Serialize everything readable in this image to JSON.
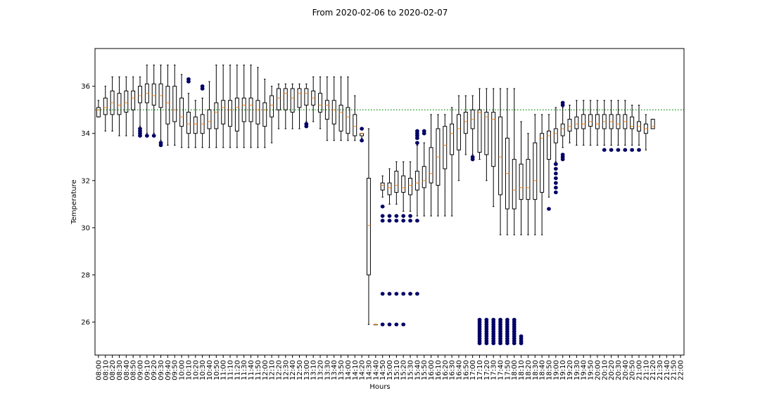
{
  "chart_data": {
    "type": "box",
    "title": "From 2020-02-06 to 2020-02-07",
    "xlabel": "Hours",
    "ylabel": "Temperature",
    "ylim": [
      24.6,
      37.6
    ],
    "yticks": [
      26,
      28,
      30,
      32,
      34,
      36
    ],
    "reference_line": {
      "value": 35.0,
      "color": "#2ca02c",
      "style": "dotted"
    },
    "colors": {
      "box": "#000000",
      "median": "#ff7f0e",
      "outlier": "#000066",
      "frame": "#000000"
    },
    "categories": [
      "08:00",
      "08:10",
      "08:20",
      "08:30",
      "08:40",
      "08:50",
      "09:00",
      "09:10",
      "09:20",
      "09:30",
      "09:40",
      "09:50",
      "10:00",
      "10:10",
      "10:20",
      "10:30",
      "10:40",
      "10:50",
      "11:00",
      "11:10",
      "11:20",
      "11:30",
      "11:40",
      "11:50",
      "12:00",
      "12:10",
      "12:20",
      "12:30",
      "12:40",
      "12:50",
      "13:00",
      "13:10",
      "13:20",
      "13:30",
      "13:40",
      "13:50",
      "14:00",
      "14:10",
      "14:20",
      "14:30",
      "14:40",
      "14:50",
      "15:00",
      "15:10",
      "15:20",
      "15:30",
      "15:40",
      "15:50",
      "16:00",
      "16:10",
      "16:20",
      "16:30",
      "16:40",
      "16:50",
      "17:00",
      "17:10",
      "17:20",
      "17:30",
      "17:40",
      "17:50",
      "18:00",
      "18:10",
      "18:20",
      "18:30",
      "18:40",
      "18:50",
      "19:00",
      "19:10",
      "19:20",
      "19:30",
      "19:40",
      "19:50",
      "20:00",
      "20:10",
      "20:20",
      "20:30",
      "20:40",
      "20:50",
      "21:00",
      "21:10",
      "21:20",
      "21:30",
      "21:40",
      "21:50",
      "22:00"
    ],
    "boxes": [
      {
        "wl": 34.7,
        "q1": 34.7,
        "med": 35.0,
        "q3": 35.1,
        "wh": 35.4,
        "out": []
      },
      {
        "wl": 34.1,
        "q1": 34.8,
        "med": 35.1,
        "q3": 35.5,
        "wh": 36.0,
        "out": []
      },
      {
        "wl": 34.1,
        "q1": 34.8,
        "med": 35.3,
        "q3": 35.8,
        "wh": 36.4,
        "out": []
      },
      {
        "wl": 33.9,
        "q1": 34.8,
        "med": 35.2,
        "q3": 35.7,
        "wh": 36.4,
        "out": []
      },
      {
        "wl": 33.9,
        "q1": 34.9,
        "med": 35.3,
        "q3": 35.8,
        "wh": 36.4,
        "out": []
      },
      {
        "wl": 33.9,
        "q1": 35.0,
        "med": 35.5,
        "q3": 35.8,
        "wh": 36.4,
        "out": []
      },
      {
        "wl": 34.3,
        "q1": 35.3,
        "med": 35.6,
        "q3": 36.0,
        "wh": 36.4,
        "out": [
          34.2,
          34.1,
          34.0,
          33.9
        ]
      },
      {
        "wl": 34.0,
        "q1": 35.3,
        "med": 35.7,
        "q3": 36.1,
        "wh": 36.9,
        "out": [
          33.9
        ]
      },
      {
        "wl": 34.0,
        "q1": 35.2,
        "med": 35.6,
        "q3": 36.1,
        "wh": 36.9,
        "out": [
          33.9
        ]
      },
      {
        "wl": 33.7,
        "q1": 35.1,
        "med": 35.6,
        "q3": 36.1,
        "wh": 36.9,
        "out": [
          33.6,
          33.5
        ]
      },
      {
        "wl": 33.5,
        "q1": 34.4,
        "med": 35.3,
        "q3": 36.0,
        "wh": 36.9,
        "out": []
      },
      {
        "wl": 33.5,
        "q1": 34.5,
        "med": 35.0,
        "q3": 36.0,
        "wh": 36.9,
        "out": []
      },
      {
        "wl": 33.4,
        "q1": 34.3,
        "med": 34.7,
        "q3": 35.5,
        "wh": 36.5,
        "out": []
      },
      {
        "wl": 33.4,
        "q1": 34.0,
        "med": 34.4,
        "q3": 34.9,
        "wh": 35.7,
        "out": [
          36.3,
          36.2
        ]
      },
      {
        "wl": 33.4,
        "q1": 34.0,
        "med": 34.4,
        "q3": 34.7,
        "wh": 35.4,
        "out": []
      },
      {
        "wl": 33.4,
        "q1": 34.0,
        "med": 34.4,
        "q3": 34.8,
        "wh": 35.5,
        "out": [
          36.0,
          35.9
        ]
      },
      {
        "wl": 33.4,
        "q1": 34.2,
        "med": 34.5,
        "q3": 35.0,
        "wh": 36.2,
        "out": []
      },
      {
        "wl": 33.4,
        "q1": 34.2,
        "med": 34.9,
        "q3": 35.3,
        "wh": 36.9,
        "out": []
      },
      {
        "wl": 33.4,
        "q1": 34.4,
        "med": 35.1,
        "q3": 35.4,
        "wh": 36.9,
        "out": []
      },
      {
        "wl": 33.4,
        "q1": 34.3,
        "med": 35.0,
        "q3": 35.4,
        "wh": 36.9,
        "out": []
      },
      {
        "wl": 33.4,
        "q1": 34.1,
        "med": 35.1,
        "q3": 35.5,
        "wh": 36.9,
        "out": []
      },
      {
        "wl": 33.4,
        "q1": 34.5,
        "med": 35.2,
        "q3": 35.5,
        "wh": 36.9,
        "out": []
      },
      {
        "wl": 33.4,
        "q1": 34.5,
        "med": 35.2,
        "q3": 35.5,
        "wh": 36.9,
        "out": []
      },
      {
        "wl": 33.4,
        "q1": 34.4,
        "med": 35.0,
        "q3": 35.4,
        "wh": 36.8,
        "out": []
      },
      {
        "wl": 33.4,
        "q1": 34.3,
        "med": 35.0,
        "q3": 35.3,
        "wh": 36.3,
        "out": []
      },
      {
        "wl": 33.6,
        "q1": 34.7,
        "med": 35.2,
        "q3": 35.6,
        "wh": 36.0,
        "out": []
      },
      {
        "wl": 34.2,
        "q1": 35.0,
        "med": 35.5,
        "q3": 35.9,
        "wh": 36.1,
        "out": []
      },
      {
        "wl": 34.2,
        "q1": 35.0,
        "med": 35.7,
        "q3": 35.9,
        "wh": 36.1,
        "out": []
      },
      {
        "wl": 34.2,
        "q1": 34.9,
        "med": 35.5,
        "q3": 35.9,
        "wh": 36.1,
        "out": []
      },
      {
        "wl": 34.2,
        "q1": 35.1,
        "med": 35.7,
        "q3": 35.9,
        "wh": 36.1,
        "out": []
      },
      {
        "wl": 34.5,
        "q1": 35.2,
        "med": 35.7,
        "q3": 35.9,
        "wh": 36.1,
        "out": [
          34.4,
          34.3
        ]
      },
      {
        "wl": 34.5,
        "q1": 35.2,
        "med": 35.5,
        "q3": 35.8,
        "wh": 36.4,
        "out": []
      },
      {
        "wl": 34.2,
        "q1": 34.9,
        "med": 35.2,
        "q3": 35.7,
        "wh": 36.4,
        "out": []
      },
      {
        "wl": 33.7,
        "q1": 34.6,
        "med": 35.2,
        "q3": 35.4,
        "wh": 36.4,
        "out": []
      },
      {
        "wl": 33.7,
        "q1": 34.4,
        "med": 35.0,
        "q3": 35.4,
        "wh": 36.4,
        "out": []
      },
      {
        "wl": 33.7,
        "q1": 34.1,
        "med": 34.9,
        "q3": 35.2,
        "wh": 36.4,
        "out": []
      },
      {
        "wl": 33.7,
        "q1": 34.0,
        "med": 34.7,
        "q3": 35.1,
        "wh": 36.4,
        "out": []
      },
      {
        "wl": 33.7,
        "q1": 33.9,
        "med": 34.3,
        "q3": 34.8,
        "wh": 35.6,
        "out": []
      },
      {
        "wl": 33.8,
        "q1": 33.9,
        "med": 34.0,
        "q3": 34.0,
        "wh": 34.0,
        "out": [
          34.2,
          33.7
        ]
      },
      {
        "wl": 25.9,
        "q1": 28.0,
        "med": 30.1,
        "q3": 32.1,
        "wh": 34.2,
        "out": []
      },
      {
        "wl": 25.9,
        "q1": 25.9,
        "med": 25.9,
        "q3": 25.9,
        "wh": 25.9,
        "out": []
      },
      {
        "wl": 31.3,
        "q1": 31.6,
        "med": 31.8,
        "q3": 31.9,
        "wh": 32.2,
        "out": [
          30.9,
          30.5,
          30.3,
          27.2,
          25.9
        ]
      },
      {
        "wl": 31.0,
        "q1": 31.4,
        "med": 31.7,
        "q3": 31.9,
        "wh": 32.5,
        "out": [
          30.5,
          30.3,
          27.2,
          25.9
        ]
      },
      {
        "wl": 31.0,
        "q1": 31.5,
        "med": 31.8,
        "q3": 32.4,
        "wh": 32.8,
        "out": [
          30.5,
          30.3,
          27.2,
          25.9
        ]
      },
      {
        "wl": 30.7,
        "q1": 31.5,
        "med": 31.7,
        "q3": 32.2,
        "wh": 32.8,
        "out": [
          30.5,
          30.3,
          27.2,
          25.9
        ]
      },
      {
        "wl": 30.7,
        "q1": 31.4,
        "med": 31.8,
        "q3": 32.1,
        "wh": 32.8,
        "out": [
          30.5,
          30.3,
          27.2
        ]
      },
      {
        "wl": 30.5,
        "q1": 31.6,
        "med": 31.9,
        "q3": 32.4,
        "wh": 33.5,
        "out": [
          34.1,
          34.0,
          33.9,
          33.8,
          33.6,
          30.3,
          27.2
        ]
      },
      {
        "wl": 30.5,
        "q1": 31.7,
        "med": 32.0,
        "q3": 32.6,
        "wh": 33.6,
        "out": [
          34.1,
          34.0
        ]
      },
      {
        "wl": 30.5,
        "q1": 31.9,
        "med": 32.3,
        "q3": 33.4,
        "wh": 34.8,
        "out": []
      },
      {
        "wl": 30.5,
        "q1": 31.8,
        "med": 33.0,
        "q3": 34.2,
        "wh": 34.8,
        "out": []
      },
      {
        "wl": 30.5,
        "q1": 32.5,
        "med": 33.5,
        "q3": 34.3,
        "wh": 34.8,
        "out": []
      },
      {
        "wl": 30.5,
        "q1": 33.1,
        "med": 34.0,
        "q3": 34.4,
        "wh": 35.1,
        "out": []
      },
      {
        "wl": 32.0,
        "q1": 33.3,
        "med": 34.2,
        "q3": 34.8,
        "wh": 35.6,
        "out": []
      },
      {
        "wl": 33.1,
        "q1": 34.0,
        "med": 34.5,
        "q3": 34.9,
        "wh": 35.6,
        "out": []
      },
      {
        "wl": 33.1,
        "q1": 34.2,
        "med": 34.6,
        "q3": 35.0,
        "wh": 35.6,
        "out": [
          33.0,
          32.9
        ]
      },
      {
        "wl": 32.9,
        "q1": 33.2,
        "med": 34.9,
        "q3": 35.0,
        "wh": 35.9,
        "out": [
          26.1,
          26.0,
          25.9,
          25.8,
          25.7,
          25.6,
          25.5,
          25.4,
          25.3,
          25.2,
          25.1
        ]
      },
      {
        "wl": 32.0,
        "q1": 33.1,
        "med": 34.7,
        "q3": 34.9,
        "wh": 35.9,
        "out": [
          26.1,
          26.0,
          25.9,
          25.8,
          25.7,
          25.6,
          25.5,
          25.4,
          25.3,
          25.2,
          25.1
        ]
      },
      {
        "wl": 30.9,
        "q1": 32.6,
        "med": 34.6,
        "q3": 34.9,
        "wh": 35.9,
        "out": [
          26.1,
          26.0,
          25.9,
          25.8,
          25.7,
          25.6,
          25.5,
          25.4,
          25.3,
          25.2,
          25.1
        ]
      },
      {
        "wl": 29.7,
        "q1": 31.4,
        "med": 33.0,
        "q3": 34.7,
        "wh": 35.9,
        "out": [
          26.1,
          26.0,
          25.9,
          25.8,
          25.7,
          25.6,
          25.5,
          25.4,
          25.3,
          25.2,
          25.1
        ]
      },
      {
        "wl": 29.7,
        "q1": 30.8,
        "med": 32.3,
        "q3": 33.8,
        "wh": 35.9,
        "out": [
          26.1,
          26.0,
          25.9,
          25.8,
          25.7,
          25.6,
          25.5,
          25.4,
          25.3,
          25.2,
          25.1
        ]
      },
      {
        "wl": 29.7,
        "q1": 30.8,
        "med": 31.6,
        "q3": 32.9,
        "wh": 35.9,
        "out": [
          26.1,
          26.0,
          25.9,
          25.8,
          25.7,
          25.6,
          25.5,
          25.4,
          25.3,
          25.2,
          25.1
        ]
      },
      {
        "wl": 29.7,
        "q1": 31.2,
        "med": 31.7,
        "q3": 32.7,
        "wh": 34.5,
        "out": [
          25.4,
          25.3,
          25.2,
          25.1
        ]
      },
      {
        "wl": 29.7,
        "q1": 31.2,
        "med": 31.7,
        "q3": 32.9,
        "wh": 34.0,
        "out": []
      },
      {
        "wl": 29.7,
        "q1": 31.2,
        "med": 32.0,
        "q3": 33.6,
        "wh": 34.8,
        "out": []
      },
      {
        "wl": 29.7,
        "q1": 31.5,
        "med": 33.8,
        "q3": 34.0,
        "wh": 34.8,
        "out": []
      },
      {
        "wl": 31.3,
        "q1": 32.9,
        "med": 33.9,
        "q3": 34.1,
        "wh": 34.8,
        "out": [
          30.8
        ]
      },
      {
        "wl": 32.8,
        "q1": 33.6,
        "med": 34.0,
        "q3": 34.2,
        "wh": 35.1,
        "out": [
          32.7,
          32.5,
          32.3,
          32.1,
          31.9,
          31.7,
          31.5
        ]
      },
      {
        "wl": 33.4,
        "q1": 33.9,
        "med": 34.2,
        "q3": 34.4,
        "wh": 35.1,
        "out": [
          35.3,
          35.2,
          33.1,
          33.0,
          32.9
        ]
      },
      {
        "wl": 33.6,
        "q1": 34.1,
        "med": 34.3,
        "q3": 34.6,
        "wh": 35.2,
        "out": []
      },
      {
        "wl": 33.5,
        "q1": 34.2,
        "med": 34.4,
        "q3": 34.7,
        "wh": 35.4,
        "out": []
      },
      {
        "wl": 33.5,
        "q1": 34.2,
        "med": 34.4,
        "q3": 34.8,
        "wh": 35.4,
        "out": []
      },
      {
        "wl": 33.5,
        "q1": 34.3,
        "med": 34.5,
        "q3": 34.8,
        "wh": 35.4,
        "out": []
      },
      {
        "wl": 33.5,
        "q1": 34.2,
        "med": 34.4,
        "q3": 34.8,
        "wh": 35.4,
        "out": []
      },
      {
        "wl": 33.5,
        "q1": 34.2,
        "med": 34.5,
        "q3": 34.8,
        "wh": 35.4,
        "out": [
          33.3
        ]
      },
      {
        "wl": 33.5,
        "q1": 34.2,
        "med": 34.5,
        "q3": 34.8,
        "wh": 35.4,
        "out": [
          33.3
        ]
      },
      {
        "wl": 33.5,
        "q1": 34.2,
        "med": 34.4,
        "q3": 34.8,
        "wh": 35.4,
        "out": [
          33.3
        ]
      },
      {
        "wl": 33.5,
        "q1": 34.2,
        "med": 34.5,
        "q3": 34.8,
        "wh": 35.4,
        "out": [
          33.3
        ]
      },
      {
        "wl": 33.5,
        "q1": 34.2,
        "med": 34.3,
        "q3": 34.7,
        "wh": 35.2,
        "out": [
          33.3
        ]
      },
      {
        "wl": 33.5,
        "q1": 34.1,
        "med": 34.3,
        "q3": 34.5,
        "wh": 35.2,
        "out": [
          33.3
        ]
      },
      {
        "wl": 33.3,
        "q1": 34.0,
        "med": 34.2,
        "q3": 34.4,
        "wh": 34.8,
        "out": []
      },
      {
        "wl": 34.2,
        "q1": 34.2,
        "med": 34.3,
        "q3": 34.6,
        "wh": 34.6,
        "out": []
      },
      null,
      null,
      null,
      null,
      null,
      null
    ]
  }
}
